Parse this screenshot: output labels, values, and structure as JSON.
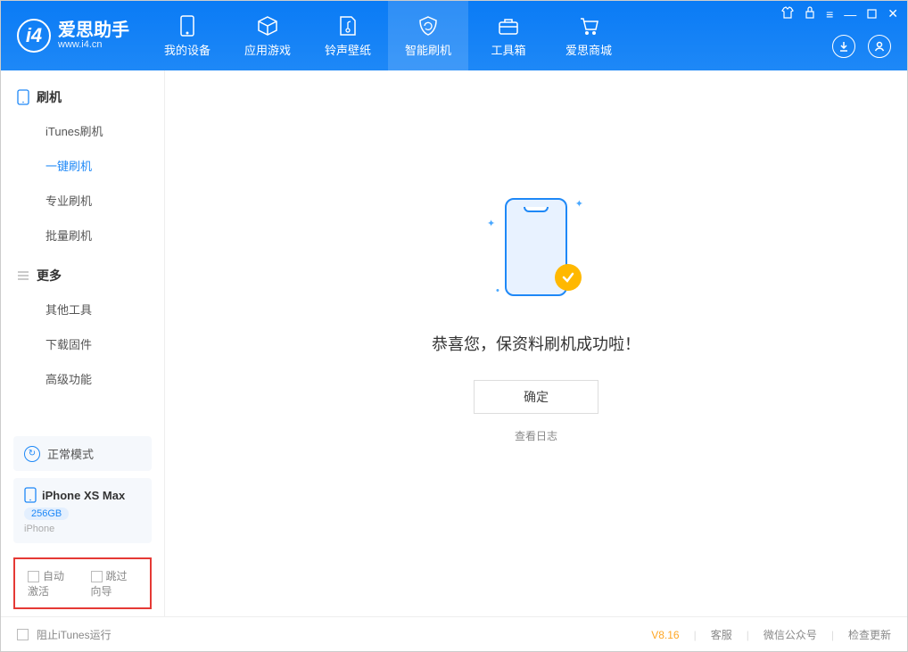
{
  "app": {
    "name": "爱思助手",
    "url": "www.i4.cn"
  },
  "tabs": [
    {
      "label": "我的设备"
    },
    {
      "label": "应用游戏"
    },
    {
      "label": "铃声壁纸"
    },
    {
      "label": "智能刷机"
    },
    {
      "label": "工具箱"
    },
    {
      "label": "爱思商城"
    }
  ],
  "sidebar": {
    "section1": {
      "title": "刷机",
      "items": [
        "iTunes刷机",
        "一键刷机",
        "专业刷机",
        "批量刷机"
      ]
    },
    "section2": {
      "title": "更多",
      "items": [
        "其他工具",
        "下载固件",
        "高级功能"
      ]
    }
  },
  "status": {
    "mode": "正常模式"
  },
  "device": {
    "name": "iPhone XS Max",
    "capacity": "256GB",
    "type": "iPhone"
  },
  "checkboxes": {
    "auto_activate": "自动激活",
    "skip_guide": "跳过向导"
  },
  "main": {
    "success": "恭喜您，保资料刷机成功啦！",
    "ok": "确定",
    "view_log": "查看日志"
  },
  "footer": {
    "block_itunes": "阻止iTunes运行",
    "version": "V8.16",
    "service": "客服",
    "wechat": "微信公众号",
    "update": "检查更新"
  }
}
